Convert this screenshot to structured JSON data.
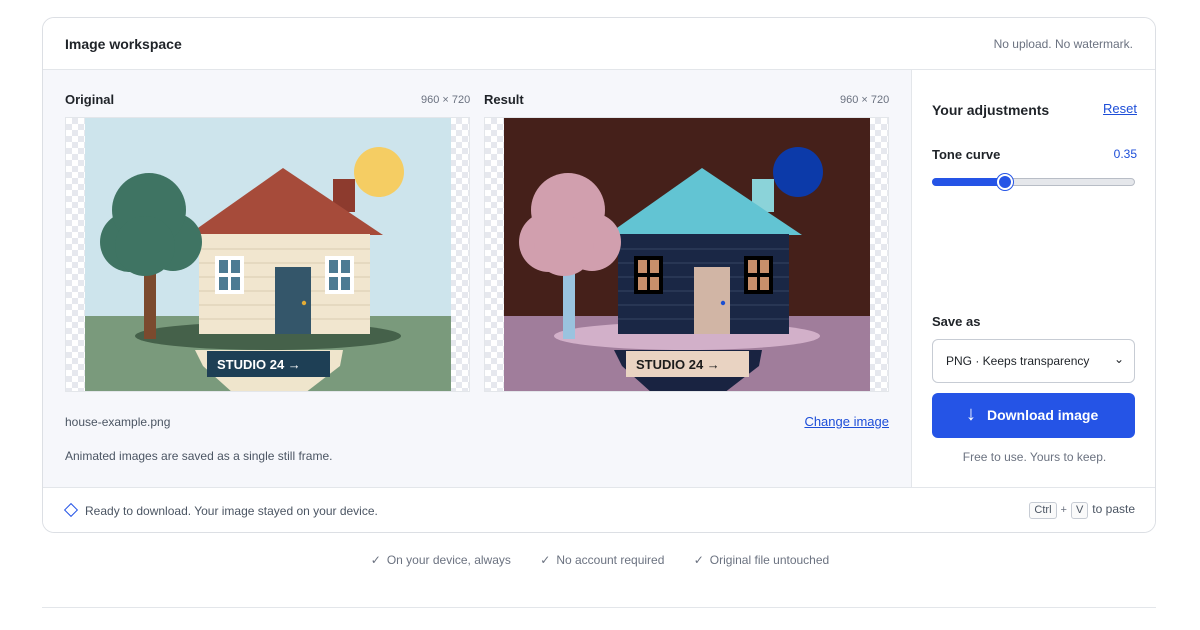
{
  "header": {
    "title": "Image workspace",
    "note": "No upload. No watermark."
  },
  "original": {
    "label": "Original",
    "dimensions": "960 × 720",
    "sign_text": "STUDIO 24 →"
  },
  "result": {
    "label": "Result",
    "dimensions": "960 × 720",
    "sign_text": "STUDIO 24 →"
  },
  "file": {
    "name": "house-example.png",
    "change_label": "Change image",
    "animated_note": "Animated images are saved as a single still frame."
  },
  "adjustments": {
    "title": "Your adjustments",
    "reset_label": "Reset",
    "tone_curve": {
      "label": "Tone curve",
      "value": "0.35",
      "fraction": 0.35
    }
  },
  "save": {
    "label": "Save as",
    "selected": "PNG · Keeps transparency",
    "download_label": "Download image",
    "free_note": "Free to use. Yours to keep."
  },
  "footer": {
    "status": "Ready to download. Your image stayed on your device.",
    "key1": "Ctrl",
    "plus": "+",
    "key2": "V",
    "paste_text": "to paste"
  },
  "trust": [
    "On your device, always",
    "No account required",
    "Original file untouched"
  ],
  "icons": {
    "status": "diamond-icon",
    "download": "arrow-down-icon",
    "select": "chevron-down-icon",
    "check": "check-icon"
  },
  "colors": {
    "accent": "#2554e6",
    "link": "#1d4ed8"
  }
}
